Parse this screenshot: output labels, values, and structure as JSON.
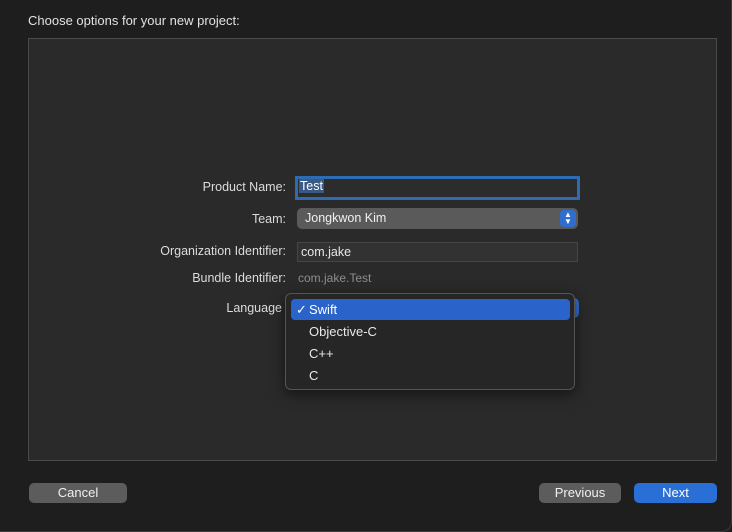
{
  "dialog": {
    "heading": "Choose options for your new project:"
  },
  "form": {
    "product_name_label": "Product Name:",
    "product_name_value": "Test",
    "team_label": "Team:",
    "team_value": "Jongkwon Kim",
    "org_id_label": "Organization Identifier:",
    "org_id_value": "com.jake",
    "bundle_id_label": "Bundle Identifier:",
    "bundle_id_value": "com.jake.Test",
    "language_label": "Language"
  },
  "language_menu": {
    "items": [
      {
        "label": "Swift",
        "checked": true
      },
      {
        "label": "Objective-C",
        "checked": false
      },
      {
        "label": "C++",
        "checked": false
      },
      {
        "label": "C",
        "checked": false
      }
    ],
    "check_mark": "✓"
  },
  "buttons": {
    "cancel": "Cancel",
    "previous": "Previous",
    "next": "Next"
  },
  "colors": {
    "accent": "#2a63c9",
    "background": "#1e1e1e",
    "panel": "#2a2a2a"
  },
  "icons": {
    "popup_arrows": "up-down-chevron-icon",
    "check": "checkmark-icon"
  }
}
